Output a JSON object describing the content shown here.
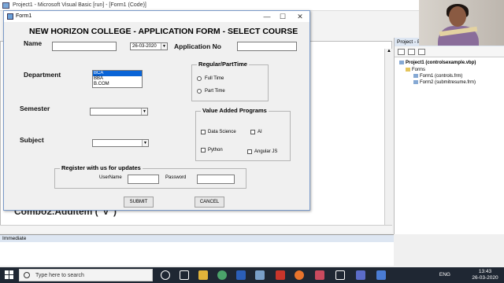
{
  "ide": {
    "title": "Project1 - Microsoft Visual Basic [run] - [Form1 (Code)]",
    "form_combo": "Fo",
    "code_line": "Combo2.AddItem (\"V\")",
    "project_panel_title": "Project - Project1",
    "project_tree": {
      "root": "Project1 (controlsexample.vbp)",
      "folder": "Forms",
      "items": [
        "Form1 (controls.frm)",
        "Form2 (submitresume.frm)"
      ]
    },
    "immediate_title": "Immediate"
  },
  "form": {
    "title": "Form1",
    "heading": "NEW HORIZON COLLEGE - APPLICATION FORM - SELECT COURSE",
    "name_label": "Name",
    "date_value": "26-03-2020",
    "application_label": "Application No",
    "department_label": "Department",
    "department_options": [
      "BCA",
      "BBA",
      "B.COM"
    ],
    "semester_label": "Semester",
    "subject_label": "Subject",
    "regular_frame": {
      "title": "Regular/PartTime",
      "options": [
        "Full Time",
        "Part Time"
      ]
    },
    "value_added_frame": {
      "title": "Value Added Programs",
      "options": [
        "Data Science",
        "AI",
        "Python",
        "Angular JS"
      ]
    },
    "register_frame": {
      "title": "Register with us for updates",
      "username_label": "UserName",
      "password_label": "Password"
    },
    "submit_label": "SUBMIT",
    "cancel_label": "CANCEL"
  },
  "window_controls": {
    "minimize": "—",
    "maximize": "☐",
    "close": "✕"
  },
  "taskbar": {
    "search_placeholder": "Type here to search",
    "language": "ENG",
    "time": "13:43",
    "date": "26-03-2020"
  },
  "colors": {
    "selection": "#0a64d6",
    "taskbar": "#1f2733"
  }
}
